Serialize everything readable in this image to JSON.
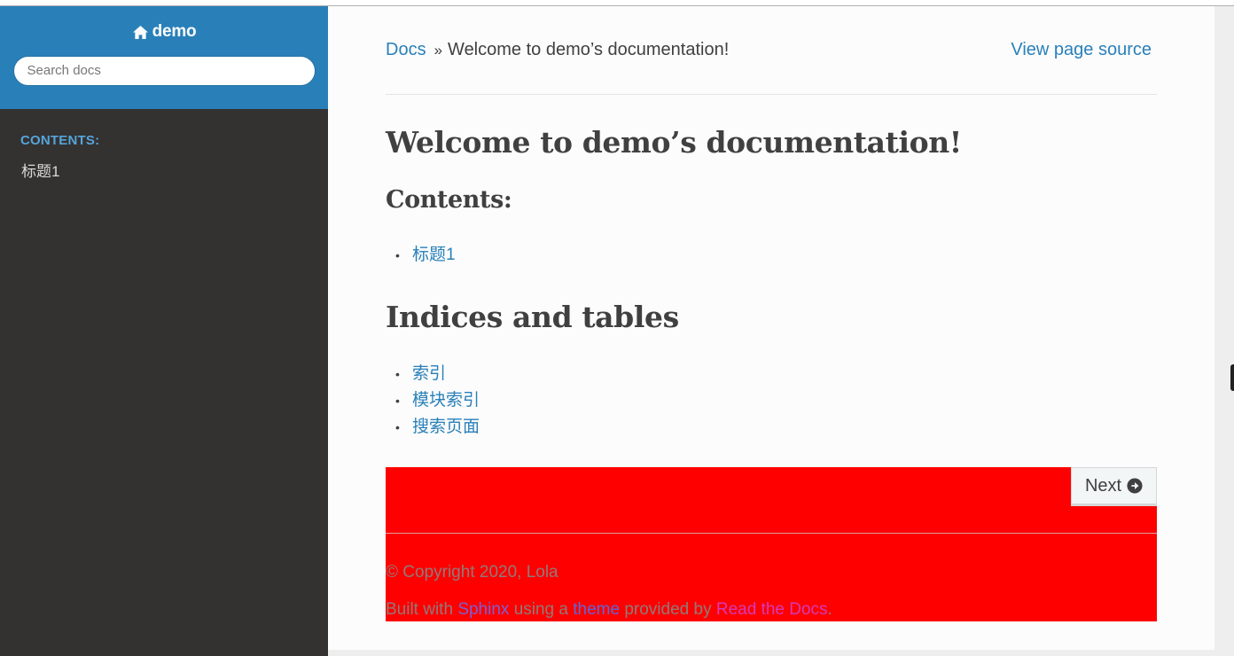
{
  "sidebar": {
    "project_name": "demo",
    "search_placeholder": "Search docs",
    "caption": "Contents:",
    "items": [
      {
        "label": "标题1"
      }
    ]
  },
  "breadcrumb": {
    "home": "Docs",
    "separator": "»",
    "current": "Welcome to demo’s documentation!",
    "view_source": "View page source"
  },
  "main": {
    "title": "Welcome to demo’s documentation!",
    "contents_heading": "Contents:",
    "contents_items": [
      "标题1"
    ],
    "indices_heading": "Indices and tables",
    "indices_items": [
      "索引",
      "模块索引",
      "搜索页面"
    ]
  },
  "footer": {
    "next_label": "Next",
    "copyright": "© Copyright 2020, Lola",
    "built_with_prefix": "Built with ",
    "sphinx": "Sphinx",
    "using_a": " using a ",
    "theme": "theme",
    "provided_by": " provided by ",
    "rtd": "Read the Docs",
    "period": "."
  },
  "colors": {
    "sidebar_top": "#2980b9",
    "sidebar_bg": "#343131",
    "link": "#2980b9",
    "footer_bg": "#ff0000"
  },
  "icons": {
    "home": "home-icon",
    "next": "arrow-circle-right-icon"
  }
}
